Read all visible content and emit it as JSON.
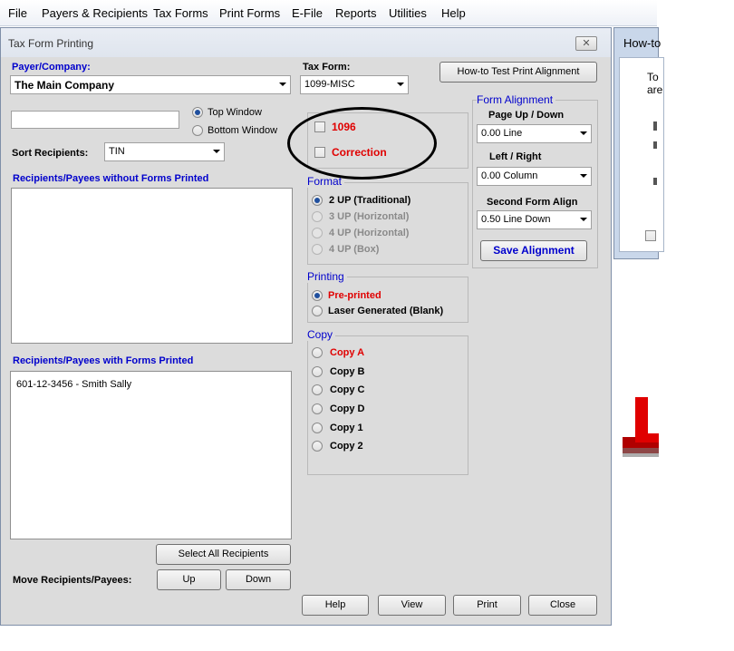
{
  "menu": [
    "File",
    "Payers & Recipients",
    "Tax Forms",
    "Print Forms",
    "E-File",
    "Reports",
    "Utilities",
    "Help"
  ],
  "background_window": {
    "title": "How-to",
    "text_lines": [
      "To",
      "are"
    ]
  },
  "dialog": {
    "title": "Tax Form Printing",
    "close_glyph": "✕"
  },
  "payer": {
    "label": "Payer/Company:",
    "value": "The Main Company"
  },
  "window_position": {
    "options": [
      "Top Window",
      "Bottom Window"
    ],
    "selected": "Top Window"
  },
  "sort": {
    "label": "Sort Recipients:",
    "value": "TIN"
  },
  "without_forms": {
    "label": "Recipients/Payees without Forms Printed",
    "items": []
  },
  "with_forms": {
    "label": "Recipients/Payees with Forms Printed",
    "items": [
      "601-12-3456 - Smith Sally"
    ]
  },
  "buttons": {
    "select_all": "Select All Recipients",
    "move_label": "Move Recipients/Payees:",
    "up": "Up",
    "down": "Down",
    "help": "Help",
    "view": "View",
    "print": "Print",
    "close": "Close",
    "howto": "How-to Test Print Alignment",
    "save_alignment": "Save Alignment"
  },
  "tax_form": {
    "label": "Tax Form:",
    "value": "1099-MISC"
  },
  "checkboxes": {
    "f1096": "1096",
    "correction": "Correction"
  },
  "format": {
    "title": "Format",
    "options": [
      "2 UP (Traditional)",
      "3 UP (Horizontal)",
      "4 UP (Horizontal)",
      "4 UP (Box)"
    ],
    "selected": "2 UP (Traditional)"
  },
  "printing": {
    "title": "Printing",
    "options": [
      "Pre-printed",
      "Laser Generated (Blank)"
    ],
    "selected": "Pre-printed"
  },
  "copy": {
    "title": "Copy",
    "options": [
      "Copy A",
      "Copy B",
      "Copy C",
      "Copy D",
      "Copy 1",
      "Copy 2"
    ]
  },
  "alignment": {
    "title": "Form Alignment",
    "page_label": "Page Up / Down",
    "page_value": "0.00 Line",
    "lr_label": "Left / Right",
    "lr_value": "0.00 Column",
    "second_label": "Second Form Align",
    "second_value": "0.50 Line Down"
  },
  "colors": {
    "accent_blue": "#0000cc",
    "alert_red": "#e00000",
    "dialog_bg": "#dcdcdc"
  }
}
